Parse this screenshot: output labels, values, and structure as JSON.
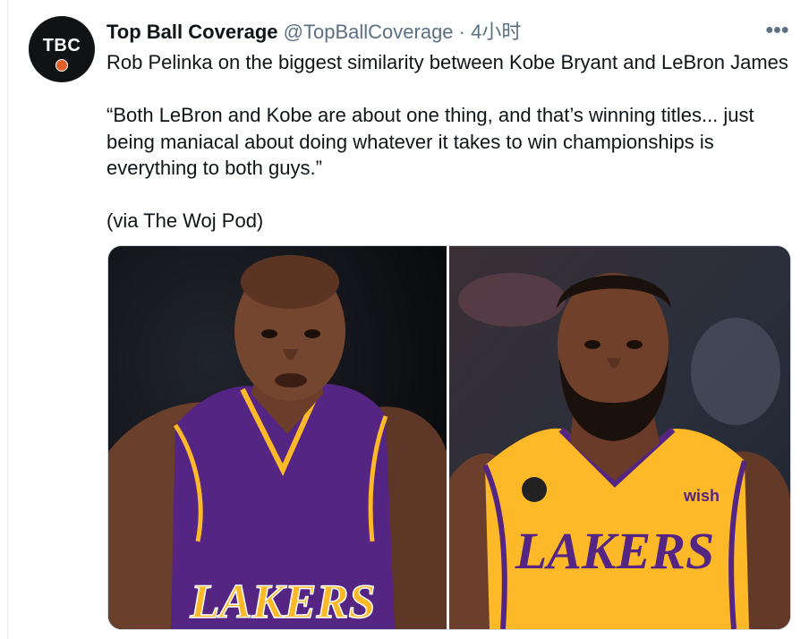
{
  "tweet": {
    "display_name": "Top Ball Coverage",
    "handle": "@TopBallCoverage",
    "separator": "·",
    "time": "4小时",
    "avatar_text": "TBC",
    "more_icon": "more-dots-icon",
    "lines": [
      "Rob Pelinka on the biggest similarity between Kobe Bryant and LeBron James",
      "“Both LeBron and Kobe are about one thing, and that’s winning titles...  just",
      "being maniacal about doing whatever it takes to win championships is",
      "everything to both guys.”",
      "(via The Woj Pod)"
    ]
  },
  "media": {
    "left_jersey_text": "LAKERS",
    "right_jersey_text": "LAKERS",
    "right_badge_text": "wish"
  },
  "colors": {
    "text": "#0f1419",
    "secondary": "#5b7083",
    "border": "#cfd9de",
    "lakers_purple": "#552583",
    "lakers_gold": "#fdb927"
  }
}
